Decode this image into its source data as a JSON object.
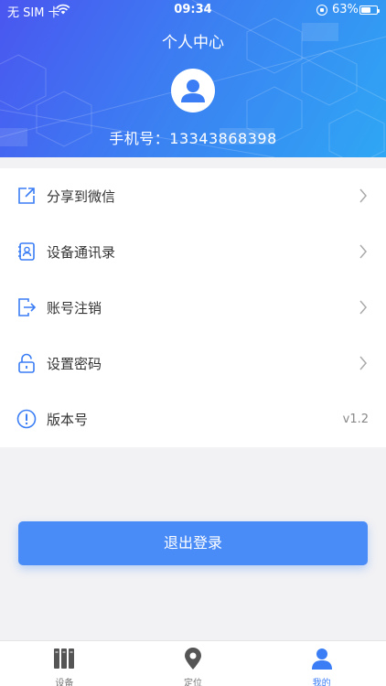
{
  "status_bar": {
    "carrier": "无 SIM 卡",
    "time": "09:34",
    "battery_percent": "63%",
    "battery_level": 0.63
  },
  "header": {
    "title": "个人中心",
    "phone_label": "手机号：",
    "phone_number": "13343868398"
  },
  "menu": [
    {
      "id": "share",
      "label": "分享到微信",
      "icon": "share-icon"
    },
    {
      "id": "contacts",
      "label": "设备通讯录",
      "icon": "contacts-icon"
    },
    {
      "id": "cancel-account",
      "label": "账号注销",
      "icon": "logout-arrow-icon"
    },
    {
      "id": "password",
      "label": "设置密码",
      "icon": "lock-icon"
    },
    {
      "id": "version",
      "label": "版本号",
      "value": "v1.2",
      "icon": "info-icon"
    }
  ],
  "logout": {
    "label": "退出登录"
  },
  "tabbar": [
    {
      "id": "devices",
      "label": "设备",
      "active": false
    },
    {
      "id": "location",
      "label": "定位",
      "active": false
    },
    {
      "id": "mine",
      "label": "我的",
      "active": true
    }
  ],
  "colors": {
    "accent": "#3a7df5",
    "header_start": "#4a56f0",
    "header_end": "#2fa7f4",
    "inactive_icon": "#555555"
  }
}
